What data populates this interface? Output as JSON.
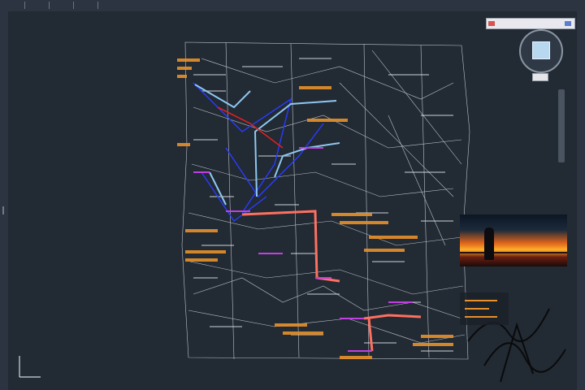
{
  "menubar": {
    "items": [
      "",
      "",
      "",
      "",
      ""
    ]
  },
  "annotation": {
    "red_note_lines": [
      "",
      "",
      "",
      "",
      ""
    ]
  },
  "viewcube": {
    "face_label": "",
    "north_label": "",
    "wcs_label": ""
  },
  "colors": {
    "background": "#222a34",
    "linework": "#d8dde2",
    "blue": "#2a3cff",
    "light_blue": "#8ec8f0",
    "red": "#e02020",
    "orange": "#e8902a",
    "magenta": "#c040e0",
    "salmon": "#ff7060"
  },
  "icons": {
    "viewcube": "viewcube-icon",
    "compass": "compass-icon",
    "ucs": "ucs-axis-icon"
  }
}
